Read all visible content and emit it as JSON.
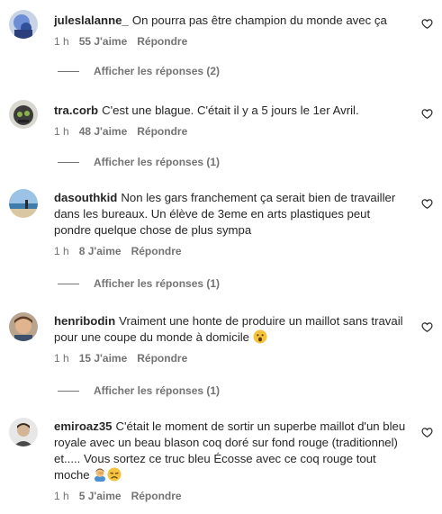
{
  "comments": [
    {
      "username": "juleslalanne_",
      "text": "On pourra pas être champion du monde avec ça",
      "time": "1 h",
      "likes": "55 J'aime",
      "reply": "Répondre",
      "view_replies": "Afficher les réponses (2)"
    },
    {
      "username": "tra.corb",
      "text": "C'est une blague. C'était il y a 5 jours le 1er Avril.",
      "time": "1 h",
      "likes": "48 J'aime",
      "reply": "Répondre",
      "view_replies": "Afficher les réponses (1)"
    },
    {
      "username": "dasouthkid",
      "text": "Non les gars franchement ça serait bien de travailler dans les bureaux. Un élève de 3eme en arts plastiques peut pondre quelque chose de plus sympa",
      "time": "1 h",
      "likes": "8 J'aime",
      "reply": "Répondre",
      "view_replies": "Afficher les réponses (1)"
    },
    {
      "username": "henribodin",
      "text": "Vraiment une honte de produire un maillot sans travail pour une coupe du monde à domicile",
      "emoji": [
        "astonished-face"
      ],
      "time": "1 h",
      "likes": "15 J'aime",
      "reply": "Répondre",
      "view_replies": "Afficher les réponses (1)"
    },
    {
      "username": "emiroaz35",
      "text": "C'était le moment de sortir un superbe maillot d'un bleu royale avec un beau blason coq doré sur fond rouge (traditionnel) et..... Vous sortez ce truc bleu Écosse avec ce coq rouge tout moche",
      "emoji": [
        "man-facepalming",
        "disappointed-face"
      ],
      "time": "1 h",
      "likes": "5 J'aime",
      "reply": "Répondre"
    }
  ],
  "icons": {
    "like": "heart-outline-icon"
  },
  "colors": {
    "text": "#262626",
    "secondary": "#737373"
  }
}
